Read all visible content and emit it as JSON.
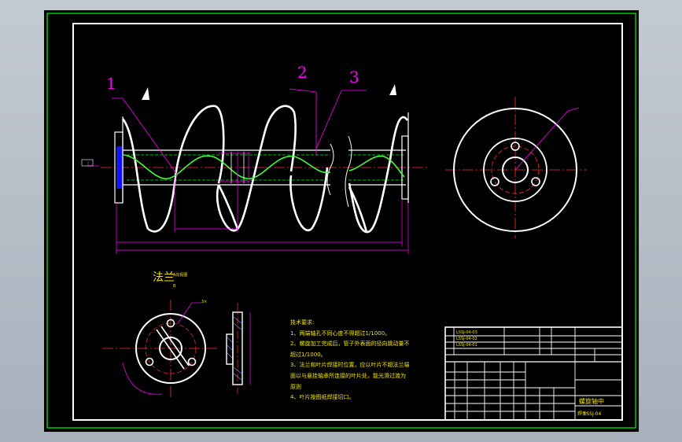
{
  "callouts": [
    "1",
    "2",
    "3"
  ],
  "section_label": "法兰",
  "section_sub": "A向视图",
  "section_sub2": "B",
  "tech_title": "技术要求:",
  "tech_notes": [
    "1、两端轴孔不同心度不得超过1/1000。",
    "2、螺旋加工完成后，管子外表面的径向跳动量不",
    "   超过1/1000。",
    "3、法兰和叶片焊接时位置，应以叶片不超法兰端",
    "   面以与悬挂轴承所连接的叶片处，能光滑过渡为",
    "   原则",
    "4、叶片按图纸焊接切口。"
  ],
  "title_block": {
    "name": "螺旋轴中",
    "code": "LSSJ-04",
    "unit": "焊件",
    "rows": [
      "LSSJ-04-03",
      "LSSJ-04-02",
      "LSSJ-04-01"
    ]
  },
  "colors": {
    "frame": "#ffffff",
    "outer_frame": "#00ff00",
    "dimension": "#ff00ff",
    "centerline": "#ff0000",
    "hidden": "#00ff00",
    "text": "#ffff00",
    "flange": "#0000ff"
  }
}
